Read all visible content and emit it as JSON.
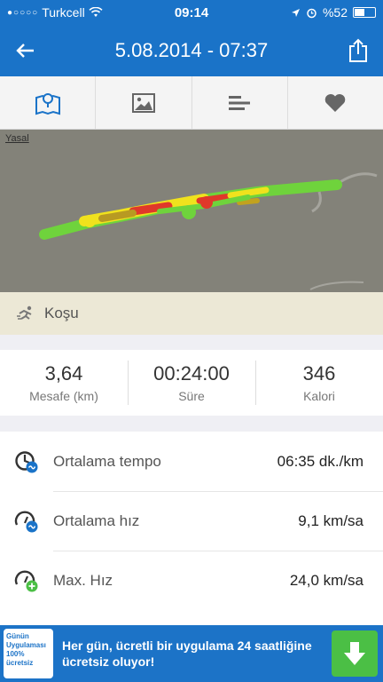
{
  "status_bar": {
    "signal": "●○○○○",
    "carrier": "Turkcell",
    "time": "09:14",
    "battery": "%52",
    "battery_level": 0.52
  },
  "header": {
    "title": "5.08.2014 - 07:37"
  },
  "tabs": [
    {
      "icon": "map-icon"
    },
    {
      "icon": "photo-icon"
    },
    {
      "icon": "splits-icon"
    },
    {
      "icon": "heart-icon"
    }
  ],
  "map": {
    "legal": "Yasal"
  },
  "activity": {
    "type": "Koşu"
  },
  "summary": [
    {
      "value": "3,64",
      "label": "Mesafe (km)"
    },
    {
      "value": "00:24:00",
      "label": "Süre"
    },
    {
      "value": "346",
      "label": "Kalori"
    }
  ],
  "stats": [
    {
      "label": "Ortalama tempo",
      "value": "06:35 dk./km",
      "icon": "pace-icon"
    },
    {
      "label": "Ortalama hız",
      "value": "9,1 km/sa",
      "icon": "avg-speed-icon"
    },
    {
      "label": "Max. Hız",
      "value": "24,0 km/sa",
      "icon": "max-speed-icon"
    }
  ],
  "ad": {
    "logo_text": "Günün Uygulaması 100% ücretsiz",
    "text": "Her gün, ücretli bir uygulama 24 saatliğine ücretsiz oluyor!"
  },
  "colors": {
    "brand": "#1a73c8",
    "route_green": "#6fd33c",
    "route_yellow": "#f0e21d",
    "route_red": "#e0382a",
    "ad_button": "#4bbf45"
  }
}
